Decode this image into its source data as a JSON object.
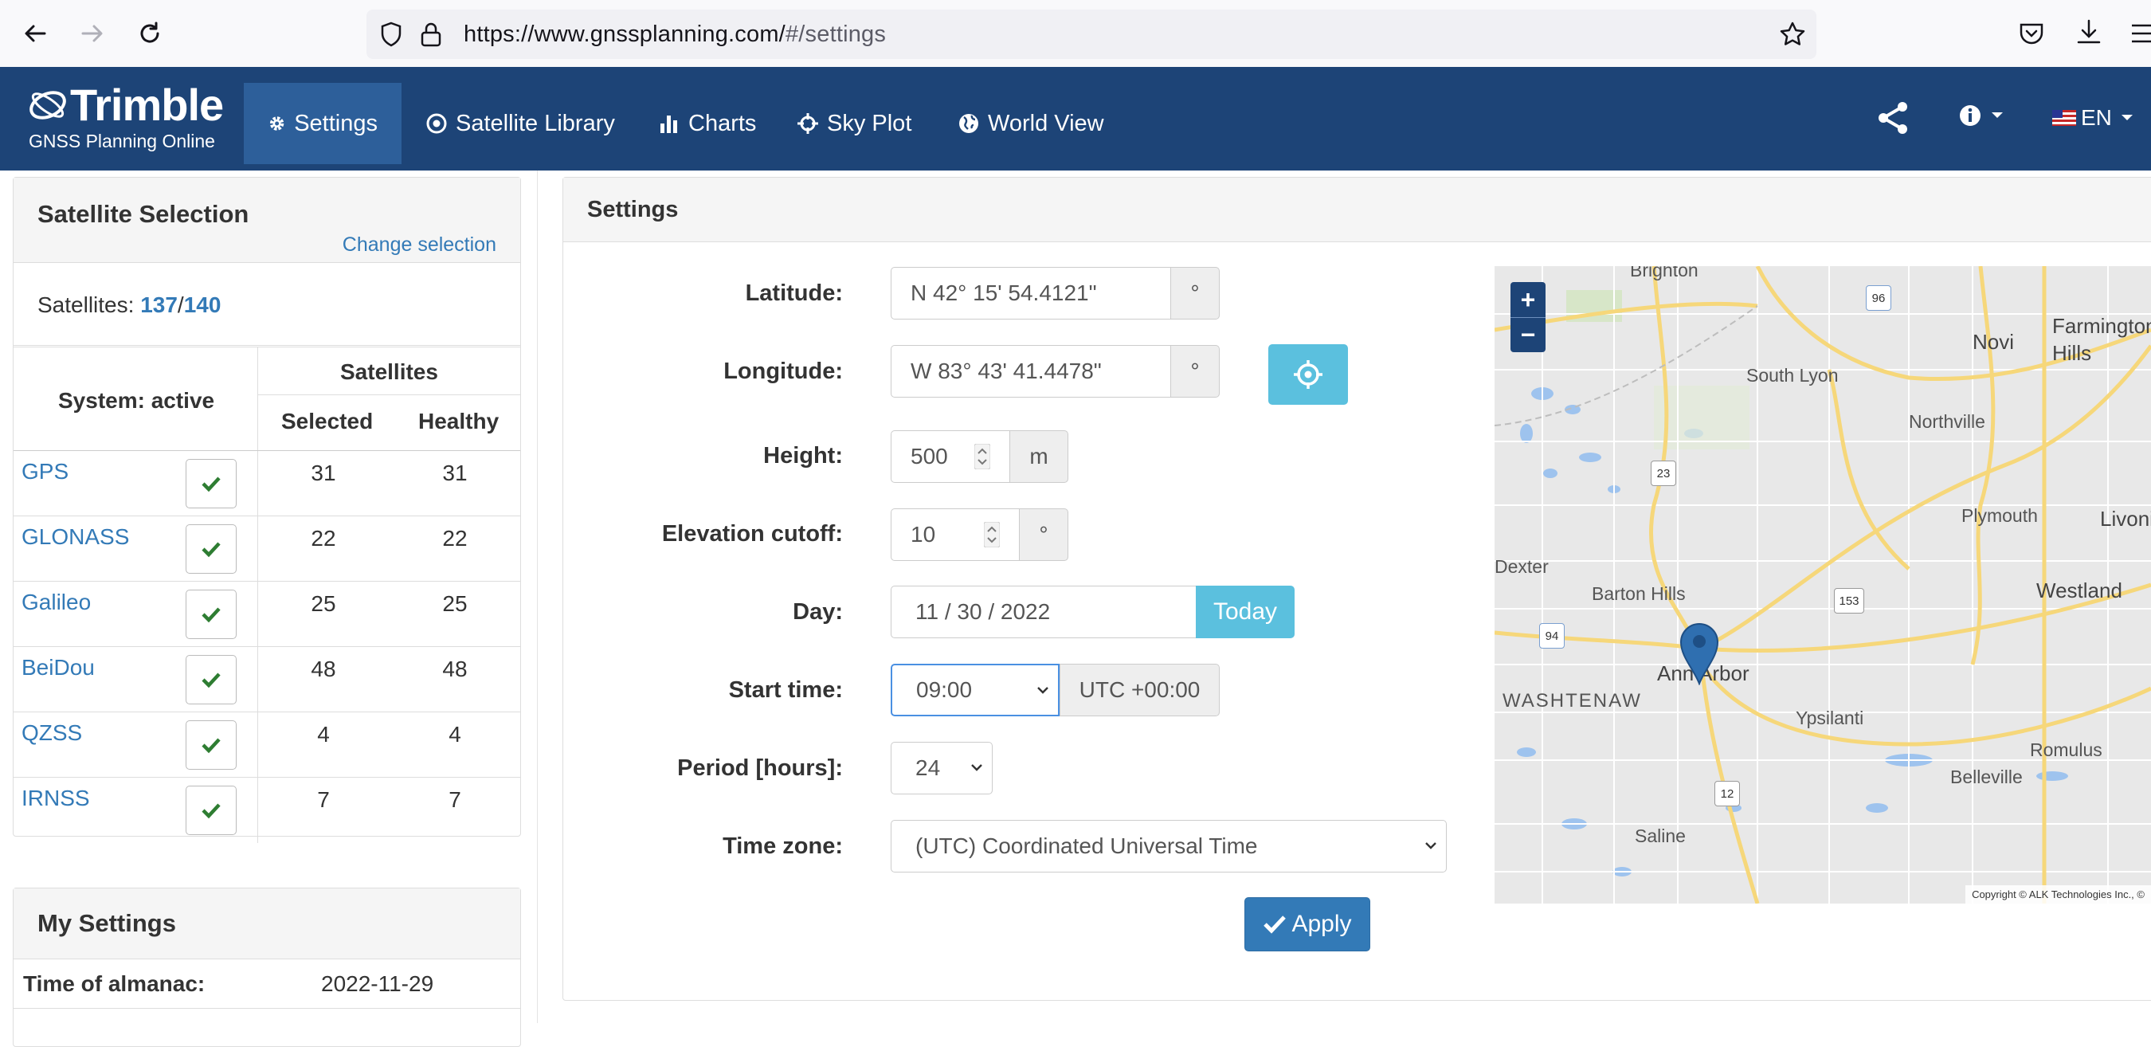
{
  "browser": {
    "url_main": "https://www.gnssplanning.com/",
    "url_rest": "#/settings"
  },
  "header": {
    "logo_text": "Trimble",
    "logo_sub": "GNSS Planning Online",
    "nav": [
      {
        "label": "Settings",
        "icon": "gear-icon",
        "active": true
      },
      {
        "label": "Satellite Library",
        "icon": "target-icon"
      },
      {
        "label": "Charts",
        "icon": "bar-chart-icon"
      },
      {
        "label": "Sky Plot",
        "icon": "crosshair-icon"
      },
      {
        "label": "World View",
        "icon": "globe-icon"
      }
    ],
    "lang": "EN"
  },
  "satellite_selection": {
    "title": "Satellite Selection",
    "change_link": "Change selection",
    "count_label": "Satellites:",
    "selected_count": "137",
    "separator": "/",
    "total_count": "140",
    "col_system": "System: active",
    "col_satellites": "Satellites",
    "col_selected": "Selected",
    "col_healthy": "Healthy",
    "rows": [
      {
        "system": "GPS",
        "selected": "31",
        "healthy": "31"
      },
      {
        "system": "GLONASS",
        "selected": "22",
        "healthy": "22"
      },
      {
        "system": "Galileo",
        "selected": "25",
        "healthy": "25"
      },
      {
        "system": "BeiDou",
        "selected": "48",
        "healthy": "48"
      },
      {
        "system": "QZSS",
        "selected": "4",
        "healthy": "4"
      },
      {
        "system": "IRNSS",
        "selected": "7",
        "healthy": "7"
      }
    ]
  },
  "my_settings": {
    "title": "My Settings",
    "almanac_label": "Time of almanac:",
    "almanac_value": "2022-11-29"
  },
  "settings": {
    "title": "Settings",
    "latitude_label": "Latitude:",
    "latitude_value": "N 42° 15' 54.4121\"",
    "longitude_label": "Longitude:",
    "longitude_value": "W 83° 43' 41.4478\"",
    "degree": "°",
    "height_label": "Height:",
    "height_value": "500",
    "height_unit": "m",
    "elevation_label": "Elevation cutoff:",
    "elevation_value": "10",
    "day_label": "Day:",
    "day_value": "11 / 30 / 2022",
    "today_button": "Today",
    "start_label": "Start time:",
    "start_value": "09:00",
    "utc_offset": "UTC +00:00",
    "period_label": "Period [hours]:",
    "period_value": "24",
    "timezone_label": "Time zone:",
    "timezone_value": "(UTC) Coordinated Universal Time",
    "apply_button": "Apply"
  },
  "map": {
    "zoom_in": "+",
    "zoom_out": "−",
    "copyright": "Copyright © ALK Technologies Inc., ©",
    "places": [
      "Brighton",
      "Novi",
      "Farmington Hills",
      "South Lyon",
      "Northville",
      "Plymouth",
      "Livonia",
      "Dexter",
      "Barton Hills",
      "Westland",
      "Ann Arbor",
      "WASHTENAW",
      "Ypsilanti",
      "Romulus",
      "Belleville",
      "Saline"
    ],
    "shields": [
      "96",
      "23",
      "153",
      "94",
      "12"
    ]
  },
  "colors": {
    "header_bg": "#1d4477",
    "nav_active": "#2d5f9a",
    "link": "#337ab7",
    "info_button": "#5bc0de",
    "apply_button": "#337ab7",
    "check_green": "#2e7d32"
  }
}
